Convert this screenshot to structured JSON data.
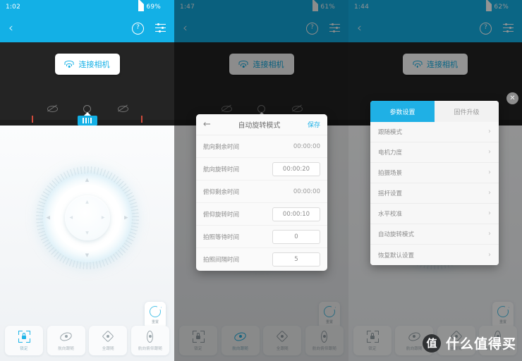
{
  "panels": [
    {
      "id": "panel-connect",
      "status": {
        "time": "1:02",
        "battery": "69%",
        "icons": [
          "location-pin-icon",
          "sd-card-icon",
          "signal-icon",
          "battery-icon"
        ]
      },
      "appbar": {
        "back": "‹",
        "help": "?",
        "menu": "menu-icon"
      },
      "connect_button": {
        "label": "连接相机",
        "icon": "wifi-icon"
      },
      "reset_card": {
        "label": "重置",
        "icon": "reset-icon"
      },
      "dial": {
        "up": "▲",
        "down": "▼",
        "left": "◀",
        "right": "▶"
      },
      "tabs": [
        {
          "label": "锁定",
          "icon": "lock-frame-icon",
          "active": true
        },
        {
          "label": "航向跟随",
          "icon": "eye-diamond-icon",
          "active": false
        },
        {
          "label": "全跟随",
          "icon": "four-way-icon",
          "active": false
        },
        {
          "label": "航向俯仰跟随",
          "icon": "vertical-eye-icon",
          "active": false
        }
      ]
    },
    {
      "id": "panel-auto-rotate",
      "status": {
        "time": "1:47",
        "battery": "61%"
      },
      "connect_button": {
        "label": "连接相机",
        "icon": "wifi-icon"
      },
      "dialog": {
        "title": "自动旋转模式",
        "back": "←",
        "save": "保存",
        "rows": [
          {
            "label": "航向剩余时间",
            "value": "00:00:00",
            "boxed": false
          },
          {
            "label": "航向旋转时间",
            "value": "00:00:20",
            "boxed": true
          },
          {
            "label": "俯仰剩余时间",
            "value": "00:00:00",
            "boxed": false
          },
          {
            "label": "俯仰旋转时间",
            "value": "00:00:10",
            "boxed": true
          },
          {
            "label": "拍照等待时间",
            "value": "0",
            "boxed": true
          },
          {
            "label": "拍照间隔时间",
            "value": "5",
            "boxed": true
          }
        ]
      },
      "tabs": [
        {
          "label": "锁定",
          "icon": "lock-frame-icon",
          "active": false
        },
        {
          "label": "航向跟随",
          "icon": "eye-diamond-icon",
          "active": true
        },
        {
          "label": "全跟随",
          "icon": "four-way-icon",
          "active": false
        },
        {
          "label": "航向俯仰跟随",
          "icon": "vertical-eye-icon",
          "active": false
        }
      ]
    },
    {
      "id": "panel-settings",
      "status": {
        "time": "1:44",
        "battery": "62%"
      },
      "connect_button": {
        "label": "连接相机",
        "icon": "wifi-icon"
      },
      "sheet": {
        "tabs": [
          {
            "label": "参数设置",
            "active": true
          },
          {
            "label": "固件升级",
            "active": false
          }
        ],
        "close": "✕",
        "items": [
          {
            "label": "跟随模式",
            "chevron": "›"
          },
          {
            "label": "电机力度",
            "chevron": "›"
          },
          {
            "label": "拍摄场景",
            "chevron": "›"
          },
          {
            "label": "摇杆设置",
            "chevron": "›"
          },
          {
            "label": "水平校准",
            "chevron": "›"
          },
          {
            "label": "自动旋转模式",
            "chevron": "›"
          },
          {
            "label": "恢复默认设置",
            "chevron": "›"
          }
        ]
      },
      "tabs": [
        {
          "label": "锁定",
          "icon": "lock-frame-icon",
          "active": false
        },
        {
          "label": "航向跟随",
          "icon": "eye-diamond-icon",
          "active": false
        },
        {
          "label": "全跟随",
          "icon": "four-way-icon",
          "active": false
        },
        {
          "label": "航向俯仰跟随",
          "icon": "vertical-eye-icon",
          "active": false
        }
      ]
    }
  ],
  "watermark": {
    "logo": "值",
    "text": "什么值得买"
  },
  "colors": {
    "accent": "#13b0e6",
    "dark": "#242424",
    "light": "#f4f6f8"
  }
}
